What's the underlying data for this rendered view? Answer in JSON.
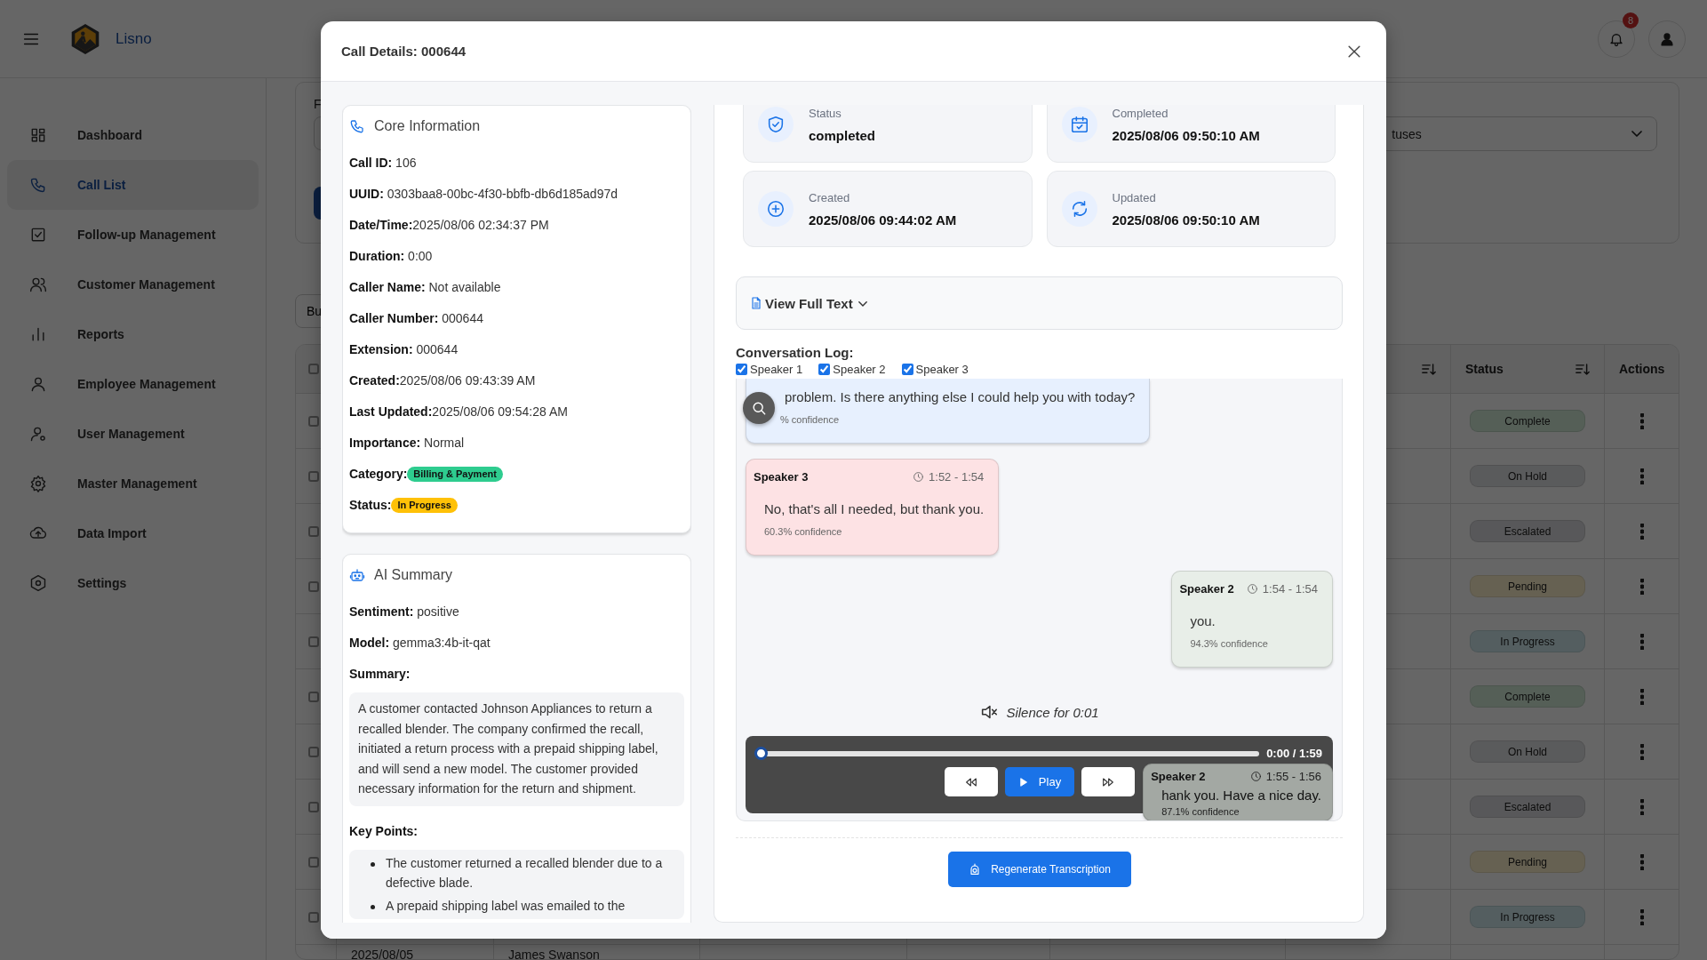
{
  "header": {
    "app_name": "Lisno",
    "notification_count": "8"
  },
  "sidebar": {
    "items": [
      {
        "label": "Dashboard",
        "selected": false
      },
      {
        "label": "Call List",
        "selected": true
      },
      {
        "label": "Follow-up Management",
        "selected": false
      },
      {
        "label": "Customer Management",
        "selected": false
      },
      {
        "label": "Reports",
        "selected": false
      },
      {
        "label": "Employee Management",
        "selected": false
      },
      {
        "label": "User Management",
        "selected": false
      },
      {
        "label": "Master Management",
        "selected": false
      },
      {
        "label": "Data Import",
        "selected": false
      },
      {
        "label": "Settings",
        "selected": false
      }
    ]
  },
  "filters": {
    "label": "F",
    "status_dropdown": "tuses"
  },
  "toolbar": {
    "button": "Bu"
  },
  "table": {
    "select_all_checked": false,
    "columns": [
      {
        "sortable": true
      },
      {
        "label": "Status",
        "sortable": true
      },
      {
        "label": "Actions",
        "sortable": false
      }
    ],
    "rows": [
      {
        "checked": false,
        "status": "Complete",
        "kind": "complete"
      },
      {
        "checked": false,
        "status": "On Hold",
        "kind": "hold"
      },
      {
        "checked": false,
        "status": "Escalated",
        "kind": "escalated"
      },
      {
        "checked": false,
        "status": "Pending",
        "kind": "pending"
      },
      {
        "checked": false,
        "status": "In Progress",
        "kind": "progress"
      },
      {
        "checked": false,
        "status": "Complete",
        "kind": "complete"
      },
      {
        "checked": false,
        "status": "On Hold",
        "kind": "hold"
      },
      {
        "checked": false,
        "status": "Escalated",
        "kind": "escalated"
      },
      {
        "checked": false,
        "status": "Pending",
        "kind": "pending"
      },
      {
        "checked": false,
        "status": "In Progress",
        "kind": "progress"
      },
      {
        "date": "2025/08/05",
        "name": "James Swanson"
      }
    ]
  },
  "modal": {
    "title": "Call Details: 000644",
    "core_information": {
      "title": "Core Information",
      "fields": [
        {
          "kind": "text",
          "text": "**Call ID:** 106"
        },
        {
          "kind": "text",
          "text": "**UUID:** 0303baa8-00bc-4f30-bbfb-db6d185ad97d"
        },
        {
          "kind": "text",
          "text": "**Date/Time:**2025/08/06 02:34:37 PM"
        },
        {
          "kind": "text",
          "text": "**Duration:** 0:00"
        },
        {
          "kind": "text",
          "text": "**Caller Name:** Not available"
        },
        {
          "kind": "text",
          "text": "**Caller Number:** 000644"
        },
        {
          "kind": "text",
          "text": "**Extension:** 000644"
        },
        {
          "kind": "text",
          "text": "**Created:**2025/08/06 09:43:39 AM"
        },
        {
          "kind": "text",
          "text": "**Last Updated:**2025/08/06 09:54:28 AM"
        },
        {
          "kind": "text",
          "text": "**Importance:** Normal"
        },
        {
          "kind": "badge",
          "label": "Category:",
          "value": "Billing & Payment",
          "color": "#2ecc8f"
        },
        {
          "kind": "badge",
          "label": "Status:",
          "value": "In Progress",
          "color": "#ffc107"
        }
      ]
    },
    "ai_summary": {
      "title": "AI Summary",
      "fields": [
        "**Sentiment:** positive",
        "**Model:** gemma3:4b-it-qat"
      ],
      "summary_label": "Summary:",
      "summary": "A customer contacted Johnson Appliances to return a recalled blender. The company confirmed the recall, initiated a return process with a prepaid shipping label, and will send a new model. The customer provided necessary information for the return and shipment.",
      "key_points_label": "Key Points:",
      "key_points": [
        "The customer returned a recalled blender due to a defective blade.",
        "A prepaid shipping label was emailed to the"
      ]
    },
    "stats": [
      {
        "label": "Status",
        "value": "completed"
      },
      {
        "label": "Completed",
        "value": "2025/08/06 09:50:10 AM"
      },
      {
        "label": "Created",
        "value": "2025/08/06 09:44:02 AM"
      },
      {
        "label": "Updated",
        "value": "2025/08/06 09:50:10 AM"
      }
    ],
    "view_full_text": {
      "label": "View Full Text",
      "expanded": false
    },
    "conversation": {
      "title": "Conversation Log:",
      "speakers": [
        {
          "label": "Speaker 1",
          "checked": true
        },
        {
          "label": "Speaker 2",
          "checked": true
        },
        {
          "label": "Speaker 3",
          "checked": true
        }
      ],
      "messages": [
        {
          "kind": "left",
          "color": "#e7f0fe",
          "text": "problem. Is there anything else I could help you with today?",
          "confidence": "% confidence"
        },
        {
          "kind": "left",
          "color": "#fde2e4",
          "speaker": "Speaker 3",
          "time": "1:52 - 1:54",
          "text": "No, that's all I needed, but thank you.",
          "confidence": "60.3% confidence"
        },
        {
          "kind": "right",
          "color": "#e8eee8",
          "speaker": "Speaker 2",
          "time": "1:54 - 1:54",
          "text": "you.",
          "confidence": "94.3% confidence"
        },
        {
          "kind": "silence",
          "text": "Silence for 0:01"
        },
        {
          "kind": "right",
          "color": "#a3a8a3",
          "speaker": "Speaker 2",
          "time": "1:55 - 1:56",
          "text": "hank you. Have a nice day.",
          "confidence": "87.1% confidence"
        }
      ]
    },
    "player": {
      "level": 0,
      "time": "0:00 / 1:59",
      "play_label": "Play"
    },
    "regenerate_button": "Regenerate Transcription"
  }
}
